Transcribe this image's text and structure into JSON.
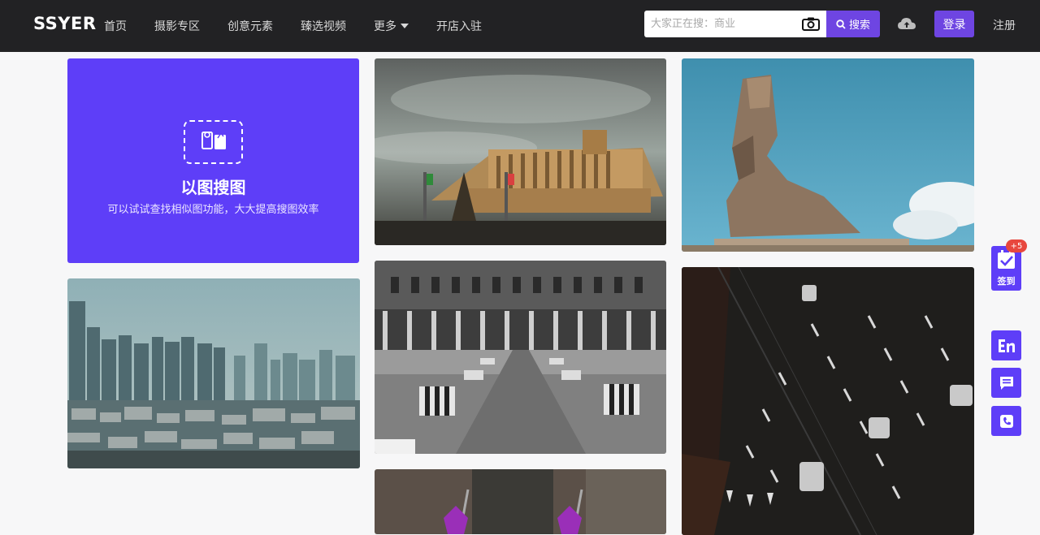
{
  "header": {
    "logo": "SSYER",
    "nav": [
      "首页",
      "摄影专区",
      "创意元素",
      "臻选视频",
      "更多",
      "开店入驻"
    ],
    "search_placeholder": "大家正在搜：商业",
    "search_button": "搜索",
    "login": "登录",
    "register": "注册"
  },
  "promo": {
    "title": "以图搜图",
    "subtitle": "可以试试查找相似图功能，大大提高搜图效率"
  },
  "sidebar": {
    "signin_label": "签到",
    "signin_badge": "+5"
  },
  "colors": {
    "accent": "#5e3ef8",
    "button": "#6e45e2",
    "header_bg": "#222224",
    "badge": "#e8473e"
  },
  "icons": [
    "camera-icon",
    "search-icon",
    "cloud-upload-icon",
    "image-search-icon",
    "calendar-check-icon",
    "en-icon",
    "chat-icon",
    "phone-icon"
  ]
}
